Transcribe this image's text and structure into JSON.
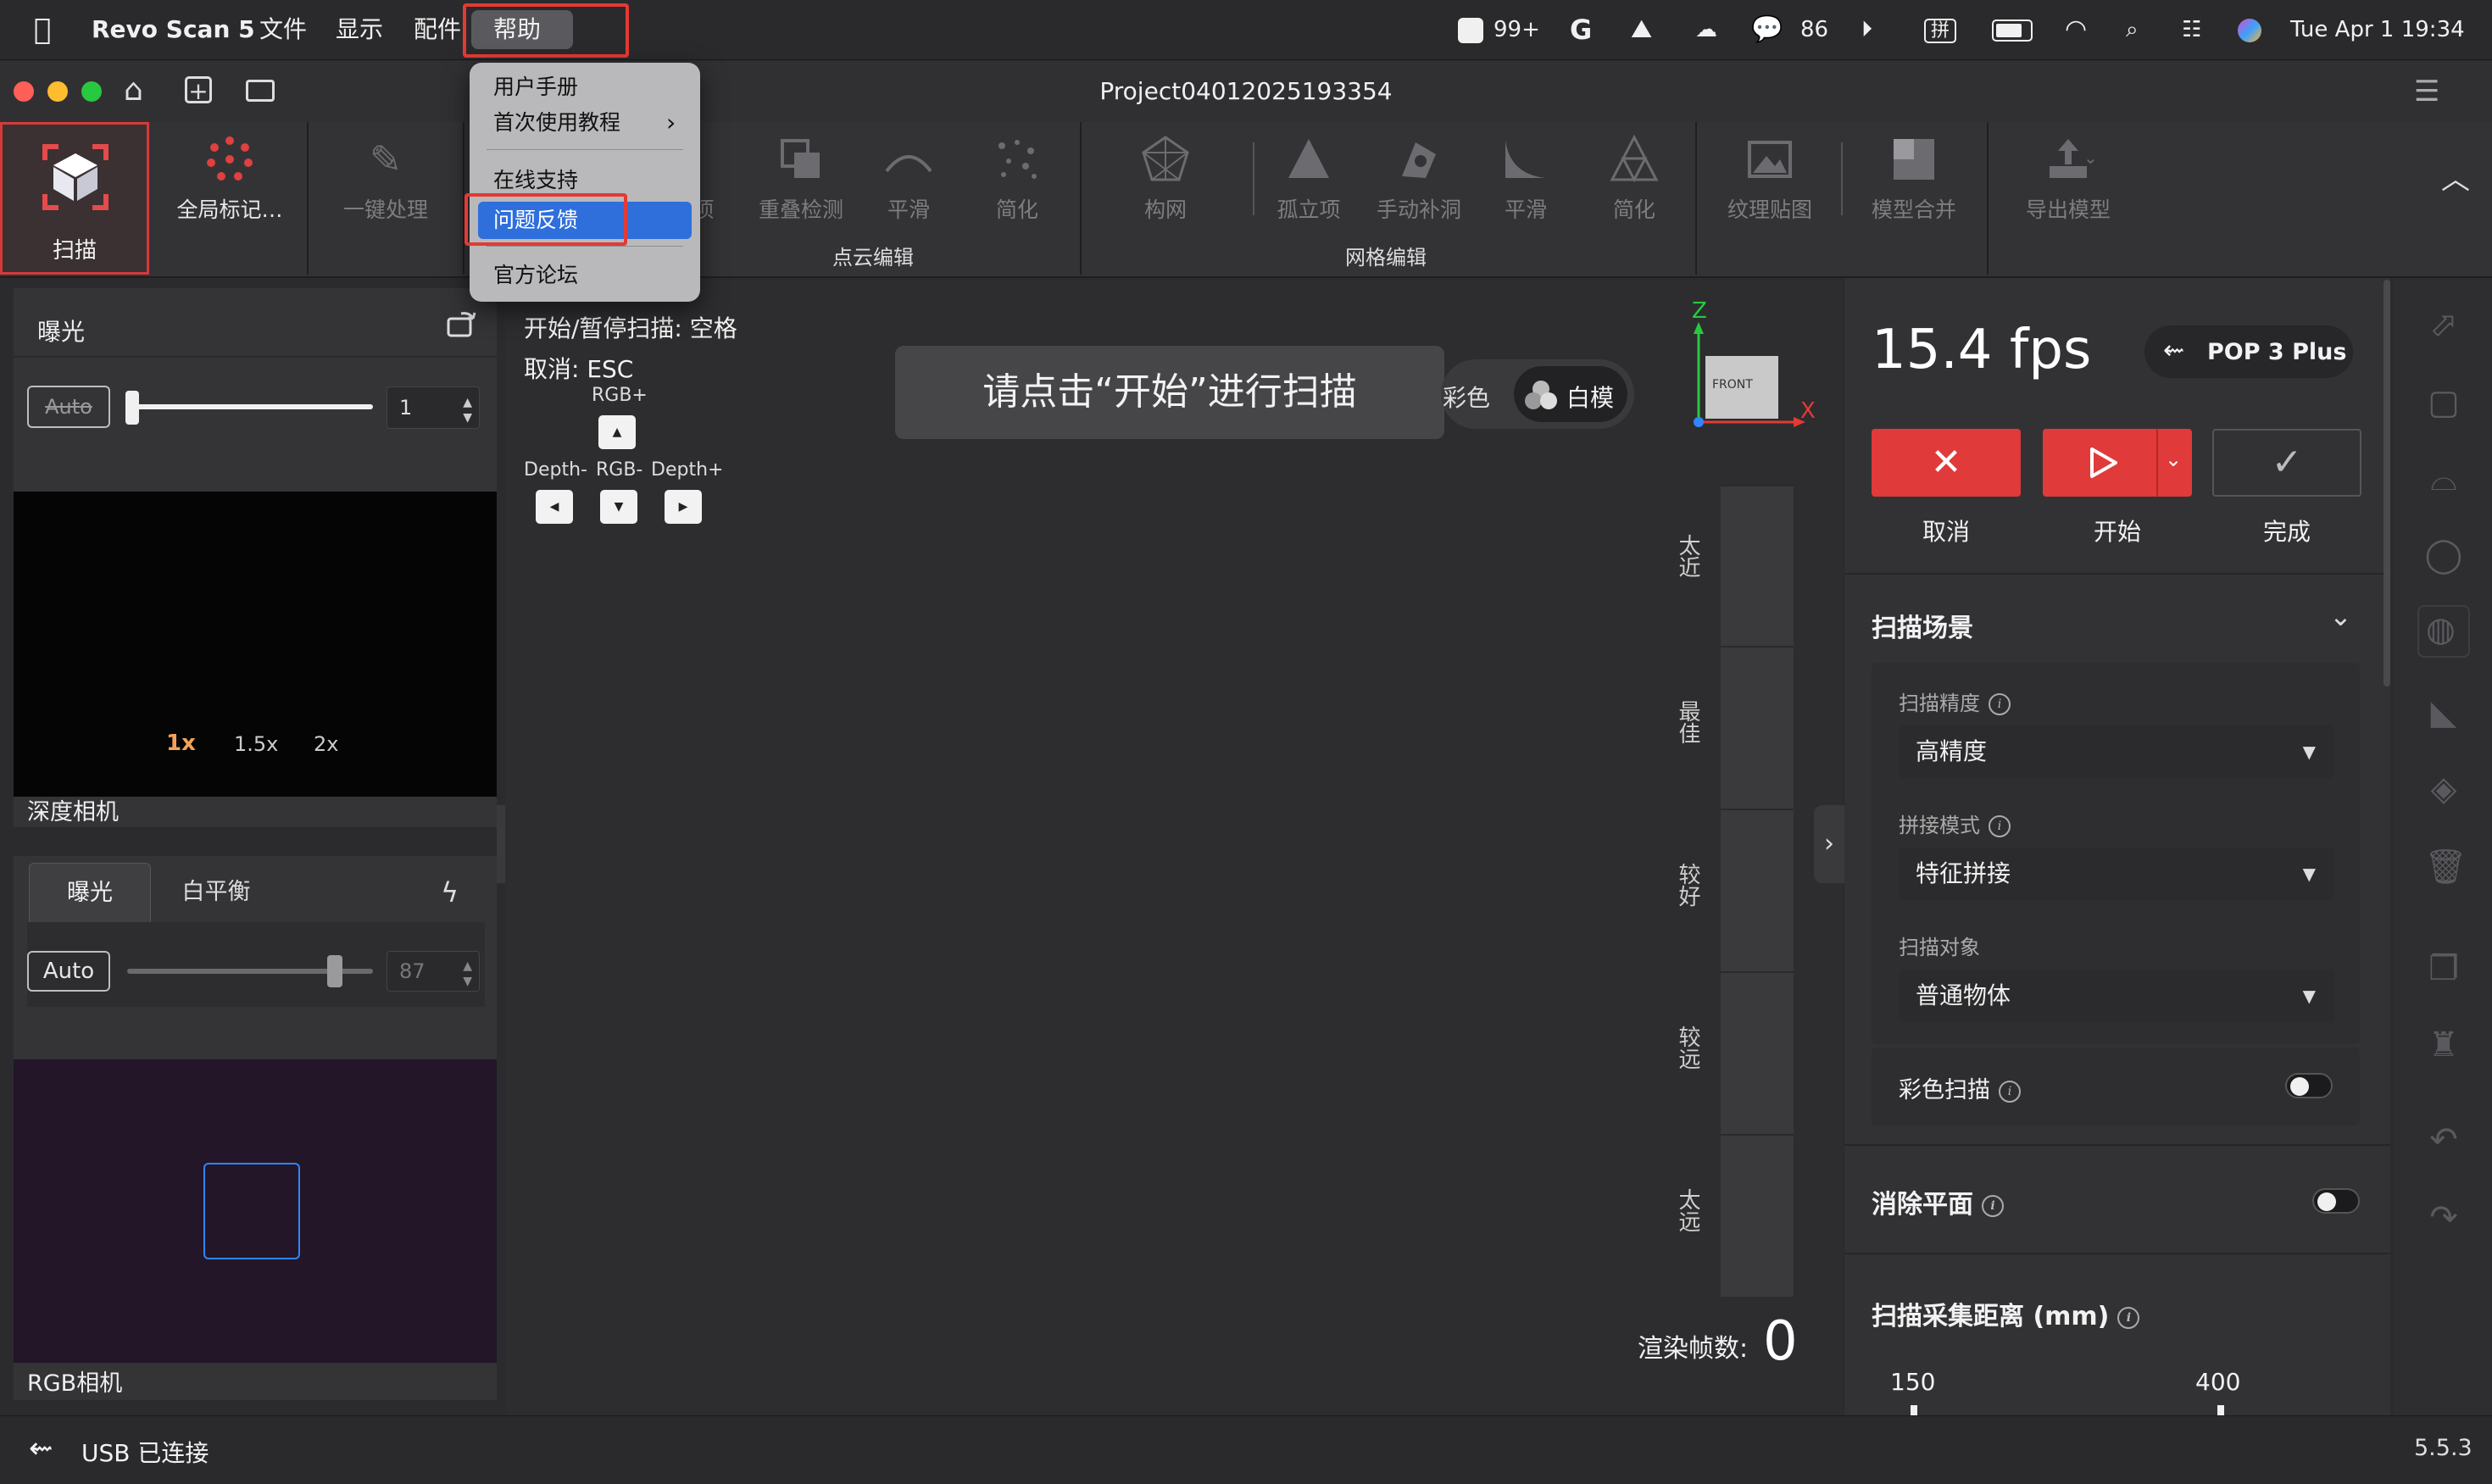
{
  "menubar": {
    "app_name": "Revo Scan 5",
    "menus": [
      "文件",
      "显示",
      "配件",
      "帮助"
    ],
    "status": {
      "notifications": "99+",
      "wechat_count": "86",
      "input_method": "拼",
      "datetime": "Tue Apr 1  19:34"
    }
  },
  "window": {
    "title": "Project04012025193354"
  },
  "help_menu": {
    "items": [
      "用户手册",
      "首次使用教程",
      "在线支持",
      "问题反馈",
      "官方论坛"
    ],
    "selected": "问题反馈"
  },
  "toolbar": {
    "scan": "扫描",
    "global_markers": "全局标记…",
    "one_click": "一键处理",
    "isolated": "项",
    "overlap": "重叠检测",
    "smooth1": "平滑",
    "simplify1": "简化",
    "pointcloud_group": "点云编辑",
    "mesh": "构网",
    "isolated2": "孤立项",
    "fill_holes": "手动补洞",
    "smooth2": "平滑",
    "simplify2": "简化",
    "mesh_group": "网格编辑",
    "texture": "纹理贴图",
    "merge": "模型合并",
    "export": "导出模型"
  },
  "left_panel": {
    "exposure_title": "曝光",
    "depth_auto": "Auto",
    "depth_exposure_value": "1",
    "zoom_levels": [
      "1x",
      "1.5x",
      "2x"
    ],
    "active_zoom": "1x",
    "depth_camera_label": "深度相机",
    "tabs": [
      "曝光",
      "白平衡"
    ],
    "rgb_auto": "Auto",
    "rgb_exposure_value": "87",
    "rgb_camera_label": "RGB相机"
  },
  "viewport": {
    "start_pause_hint": "开始/暂停扫描: 空格",
    "cancel_hint": "取消: ESC",
    "keys": {
      "rgb_plus": "RGB+",
      "depth_minus": "Depth-",
      "rgb_minus": "RGB-",
      "depth_plus": "Depth+"
    },
    "toast": "请点击“开始”进行扫描",
    "mode_color": "彩色",
    "mode_white": "白模",
    "axis": {
      "z": "Z",
      "x": "X",
      "cube_face": "FRONT"
    },
    "distance_levels": [
      "太近",
      "最佳",
      "较好",
      "较远",
      "太远"
    ],
    "render_fps_label": "渲染帧数:",
    "render_fps_value": "0"
  },
  "right_panel": {
    "fps": "15.4 fps",
    "device": "POP 3 Plus",
    "cancel_label": "取消",
    "start_label": "开始",
    "done_label": "完成",
    "scene_title": "扫描场景",
    "precision_label": "扫描精度",
    "precision_value": "高精度",
    "stitch_label": "拼接模式",
    "stitch_value": "特征拼接",
    "object_label": "扫描对象",
    "object_value": "普通物体",
    "color_scan_label": "彩色扫描",
    "remove_plane_label": "消除平面",
    "distance_title": "扫描采集距离 (mm)",
    "distance_min": "150",
    "distance_max": "400"
  },
  "statusbar": {
    "connection": "USB 已连接",
    "version": "5.5.3"
  },
  "colors": {
    "accent_red": "#e03a3a",
    "selection_blue": "#2f6fdc",
    "scan_tile_red": "#e54b4b"
  }
}
